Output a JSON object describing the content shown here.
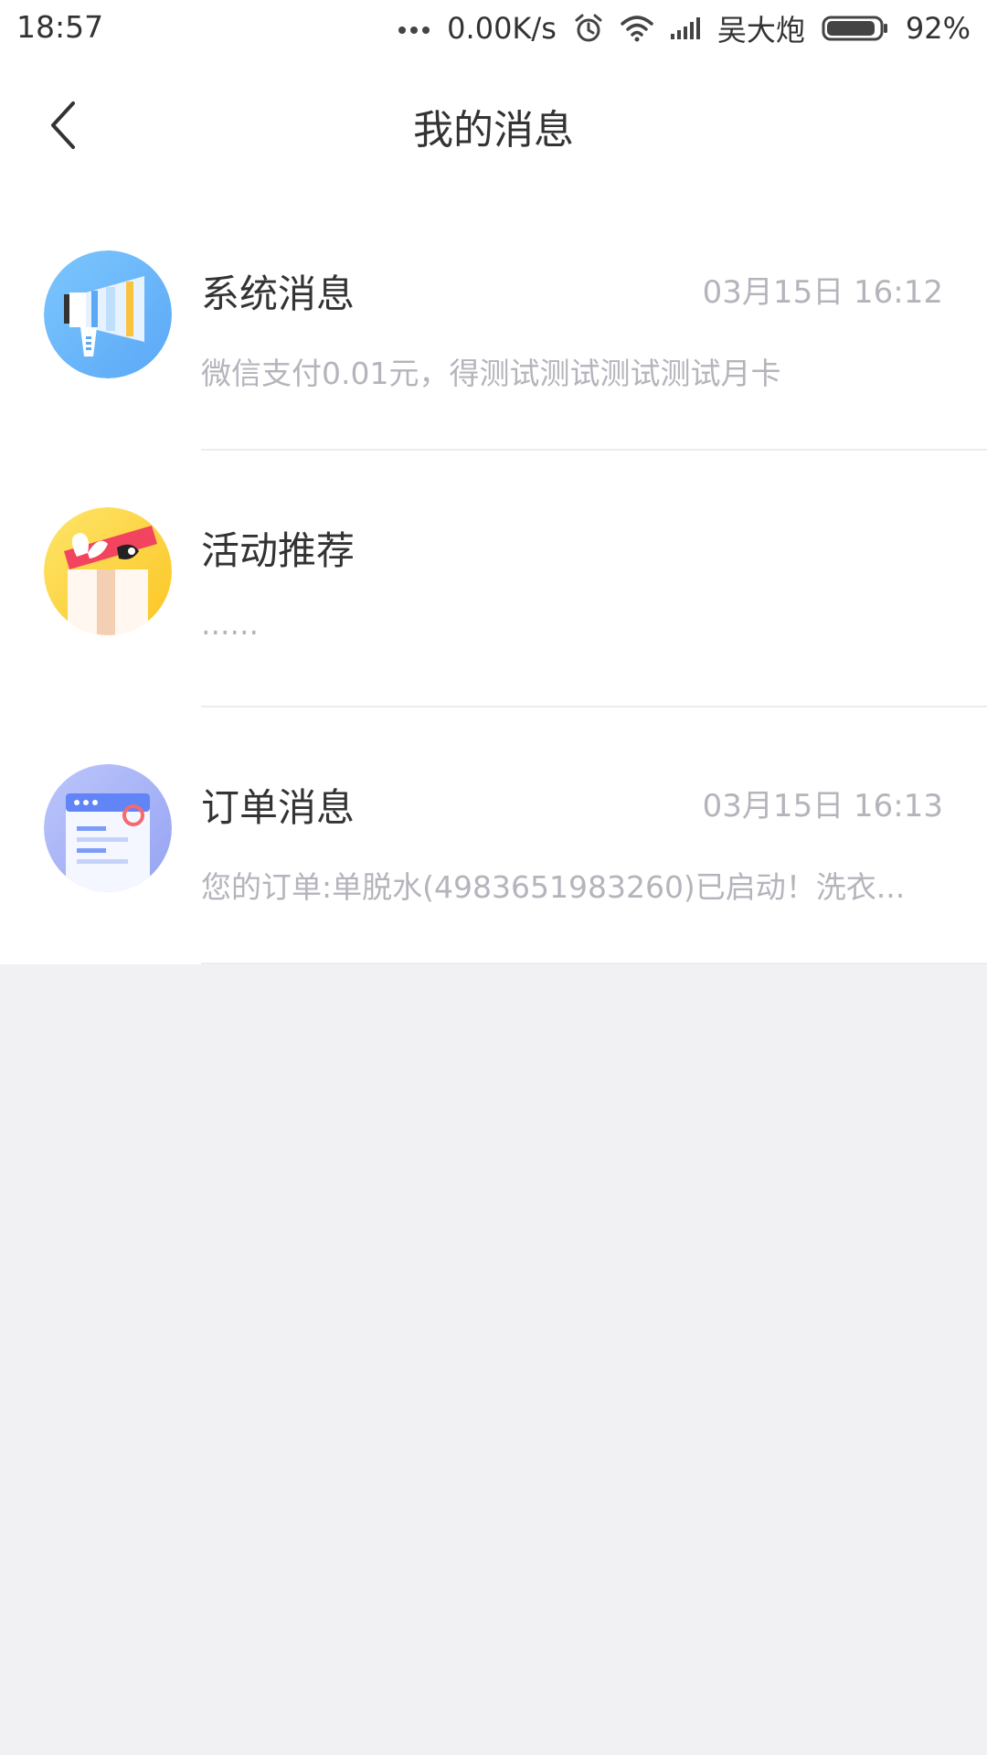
{
  "status_bar": {
    "time": "18:57",
    "network_speed": "0.00K/s",
    "carrier": "吴大炮",
    "battery": "92%",
    "battery_level": 0.92
  },
  "header": {
    "title": "我的消息",
    "back_icon": "chevron-left-icon"
  },
  "messages": [
    {
      "title": "系统消息",
      "time": "03月15日 16:12",
      "preview": "微信支付0.01元，得测试测试测试测试月卡",
      "icon": "megaphone-icon"
    },
    {
      "title": "活动推荐",
      "time": "",
      "preview": "......",
      "icon": "gift-icon"
    },
    {
      "title": "订单消息",
      "time": "03月15日 16:13",
      "preview": "您的订单:单脱水(4983651983260)已启动！洗衣...",
      "icon": "order-document-icon"
    }
  ],
  "colors": {
    "background": "#f1f1f3",
    "text_primary": "#333333",
    "text_secondary": "#b4b4bc",
    "system_icon": "#6ab8fb",
    "activity_icon": "#fdd83c",
    "order_icon": "#a7b3f5"
  }
}
